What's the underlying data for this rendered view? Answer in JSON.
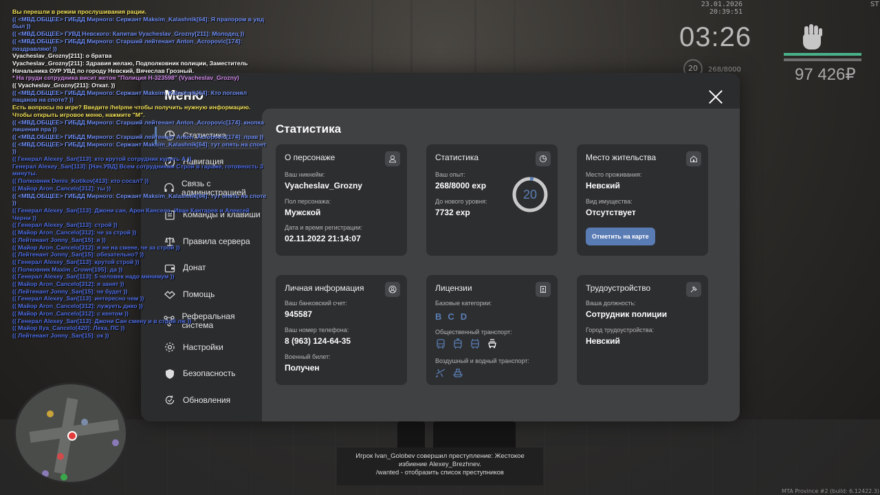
{
  "hud": {
    "datetime": "23.01.2026 20:39:51",
    "corner_text": "ST",
    "clock": "03:26",
    "level": "20",
    "exp": "268/8000",
    "money": "97 426₽",
    "build": "MTA Province #2 (build: 6.12422.3)"
  },
  "chat": [
    {
      "text": "Вы перешли в режим прослушивания рации.",
      "color": "#f5e45a"
    },
    {
      "text": "(( <МВД.ОБЩЕЕ> ГИБДД Мирного: Сержант Maksim_Kalashnik[64]: Я прапором в увд был ))",
      "color": "#6f8ff7"
    },
    {
      "text": "(( <МВД.ОБЩЕЕ> ГУВД Невского: Капитан Vyacheslav_Grozny[211]: Молодец ))",
      "color": "#6f8ff7"
    },
    {
      "text": "(( <МВД.ОБЩЕЕ> ГИБДД Мирного: Старший лейтенант Anton_Acropovic[174]: поздравляю! ))",
      "color": "#6f8ff7"
    },
    {
      "text": "Vyacheslav_Grozny[211]: о братва",
      "color_name": "#6f8ff7",
      "color": "#ffffff"
    },
    {
      "text": "Vyacheslav_Grozny[211]: Здравия желаю, Подполковник полиции, Заместитель Начальника ОУР УВД по городу Невский, Вячеслав Грозный.",
      "color": "#ffffff"
    },
    {
      "text": "* На груди сотрудника висит жетон \"Полиция Н-323598\" (Vyacheslav_Grozny)",
      "color": "#d68cf0"
    },
    {
      "text": "(( Vyacheslav_Grozny[211]: Откат. ))",
      "color": "#ffffff"
    },
    {
      "text": "(( <МВД.ОБЩЕЕ> ГИБДД Мирного: Сержант Maksim_Kalashnik[64]: Кто погонял пацанов на споте? ))",
      "color": "#6f8ff7"
    },
    {
      "text": "Есть вопросы по игре? Введите /helpme чтобы получить нужную информацию.",
      "color": "#f5e45a"
    },
    {
      "text": "Чтобы открыть игровое меню, нажмите \"M\".",
      "color": "#f5e45a"
    },
    {
      "text": "(( <МВД.ОБЩЕЕ> ГИБДД Мирного: Старший лейтенант Anton_Acropovic[174]: кнопка лишения пра ))",
      "color": "#6f8ff7"
    },
    {
      "text": "(( <МВД.ОБЩЕЕ> ГИБДД Мирного: Старший лейтенант Anton_Acropovic[174]: прав ))",
      "color": "#6f8ff7"
    },
    {
      "text": "(( <МВД.ОБЩЕЕ> ГИБДД Мирного: Сержант Maksim_Kalashnik[64]: тут опять на споет ))",
      "color": "#6f8ff7"
    },
    {
      "text": "(( Генерал Alexey_San[113]: кто крутой сотрудник купить А ))",
      "color": "#4f6fe8"
    },
    {
      "text": "Генерал Alexey_San[113]: [Нач.УВД] Всем сотрудникам Строй в гараже, готовность 3 минуты.",
      "color": "#4f6fe8"
    },
    {
      "text": "(( Полковник Denis_Kotikov[413]: кто сосал? ))",
      "color": "#4f6fe8"
    },
    {
      "text": "(( Майор Aron_Cancelo[312]: ты ))",
      "color": "#4f6fe8"
    },
    {
      "text": "(( <МВД.ОБЩЕЕ> ГИБДД Мирного: Сержант Maksim_Kalashnik[64]: тут опять на споте ))",
      "color": "#6f8ff7"
    },
    {
      "text": "(( Генерал Alexey_San[113]: Джони сан, Арон Кансело, Иван Кантарев и Алексей Черни ))",
      "color": "#4f6fe8"
    },
    {
      "text": "(( Генерал Alexey_San[113]: строй ))",
      "color": "#4f6fe8"
    },
    {
      "text": "(( Майор Aron_Cancelo[312]: че за строй ))",
      "color": "#4f6fe8"
    },
    {
      "text": "(( Лейтенант Jonny_San[15]: я ))",
      "color": "#4f6fe8"
    },
    {
      "text": "(( Майор Aron_Cancelo[312]: я не на смене, че за строй ))",
      "color": "#4f6fe8"
    },
    {
      "text": "(( Лейтенант Jonny_San[15]: обезательно? ))",
      "color": "#4f6fe8"
    },
    {
      "text": "(( Генерал Alexey_San[113]: крутой строй ))",
      "color": "#4f6fe8"
    },
    {
      "text": "(( Полковник Maxim_Crown[195]: да ))",
      "color": "#4f6fe8"
    },
    {
      "text": "(( Генерал Alexey_San[113]: 5 человек надо минимум ))",
      "color": "#4f6fe8"
    },
    {
      "text": "(( Майор Aron_Cancelo[312]: я занят ))",
      "color": "#4f6fe8"
    },
    {
      "text": "(( Лейтенант Jonny_San[15]: че будет ))",
      "color": "#4f6fe8"
    },
    {
      "text": "(( Генерал Alexey_San[113]: интересно чем ))",
      "color": "#4f6fe8"
    },
    {
      "text": "(( Майор Aron_Cancelo[312]: лужуеть дико ))",
      "color": "#4f6fe8"
    },
    {
      "text": "(( Майор Aron_Cancelo[312]: с кентом ))",
      "color": "#4f6fe8"
    },
    {
      "text": "(( Генерал Alexey_San[113]: Джони Сан смену и в строй лж ))",
      "color": "#4f6fe8"
    },
    {
      "text": "(( Майор Ilya_Cancelo[420]: Леха, ПС ))",
      "color": "#4f6fe8"
    },
    {
      "text": "(( Лейтенант Jonny_San[15]: ок ))",
      "color": "#4f6fe8"
    }
  ],
  "menu": {
    "title": "Меню",
    "sidebar": [
      {
        "label": "Статистика",
        "icon": "pie-chart-icon",
        "active": true
      },
      {
        "label": "Навигация",
        "icon": "compass-icon",
        "active": false
      },
      {
        "label": "Связь с администрацией",
        "icon": "headset-icon",
        "active": false
      },
      {
        "label": "Команды и клавиши",
        "icon": "keyboard-icon",
        "active": false
      },
      {
        "label": "Правила сервера",
        "icon": "scales-icon",
        "active": false
      },
      {
        "label": "Донат",
        "icon": "wallet-icon",
        "active": false
      },
      {
        "label": "Помощь",
        "icon": "handshake-icon",
        "active": false
      },
      {
        "label": "Реферальная система",
        "icon": "network-icon",
        "active": false
      },
      {
        "label": "Настройки",
        "icon": "gear-icon",
        "active": false
      },
      {
        "label": "Безопасность",
        "icon": "shield-icon",
        "active": false
      },
      {
        "label": "Обновления",
        "icon": "refresh-icon",
        "active": false
      }
    ]
  },
  "content": {
    "title": "Статистика",
    "character": {
      "title": "О персонаже",
      "nickname_label": "Ваш никнейм:",
      "nickname": "Vyacheslav_Grozny",
      "gender_label": "Пол персонажа:",
      "gender": "Мужской",
      "reg_label": "Дата и время регистрации:",
      "reg_value": "02.11.2022 21:14:07"
    },
    "stats": {
      "title": "Статистика",
      "exp_label": "Ваш опыт:",
      "exp_value": "268/8000 exp",
      "next_label": "До нового уровня:",
      "next_value": "7732 exp",
      "level": "20",
      "progress": 0.0335
    },
    "residence": {
      "title": "Место жительства",
      "place_label": "Место проживания:",
      "place": "Невский",
      "property_label": "Вид имущества:",
      "property": "Отсутствует",
      "map_button": "Отметить на карте"
    },
    "personal": {
      "title": "Личная информация",
      "bank_label": "Ваш банковский счет:",
      "bank": "945587",
      "phone_label": "Ваш номер телефона:",
      "phone": "8 (963) 124-64-35",
      "military_label": "Военный билет:",
      "military": "Получен"
    },
    "licenses": {
      "title": "Лицензии",
      "base_label": "Базовые категории:",
      "categories": [
        "B",
        "C",
        "D"
      ],
      "public_label": "Общественный транспорт:",
      "air_label": "Воздушный и водный транспорт:"
    },
    "employment": {
      "title": "Трудоустройство",
      "position_label": "Ваша должность:",
      "position": "Сотрудник полиции",
      "city_label": "Город трудоустройства:",
      "city": "Невский"
    }
  },
  "notice": {
    "line1": "Игрок Ivan_Golobev совершил преступление: Жестокое",
    "line2": "избиение Alexey_Brezhnev.",
    "line3": "/wanted - отобразить список преступников"
  },
  "colors": {
    "accent": "#5a7fb5",
    "panel": "#2b2c2e",
    "content": "#404143",
    "card": "#2d2e30"
  }
}
